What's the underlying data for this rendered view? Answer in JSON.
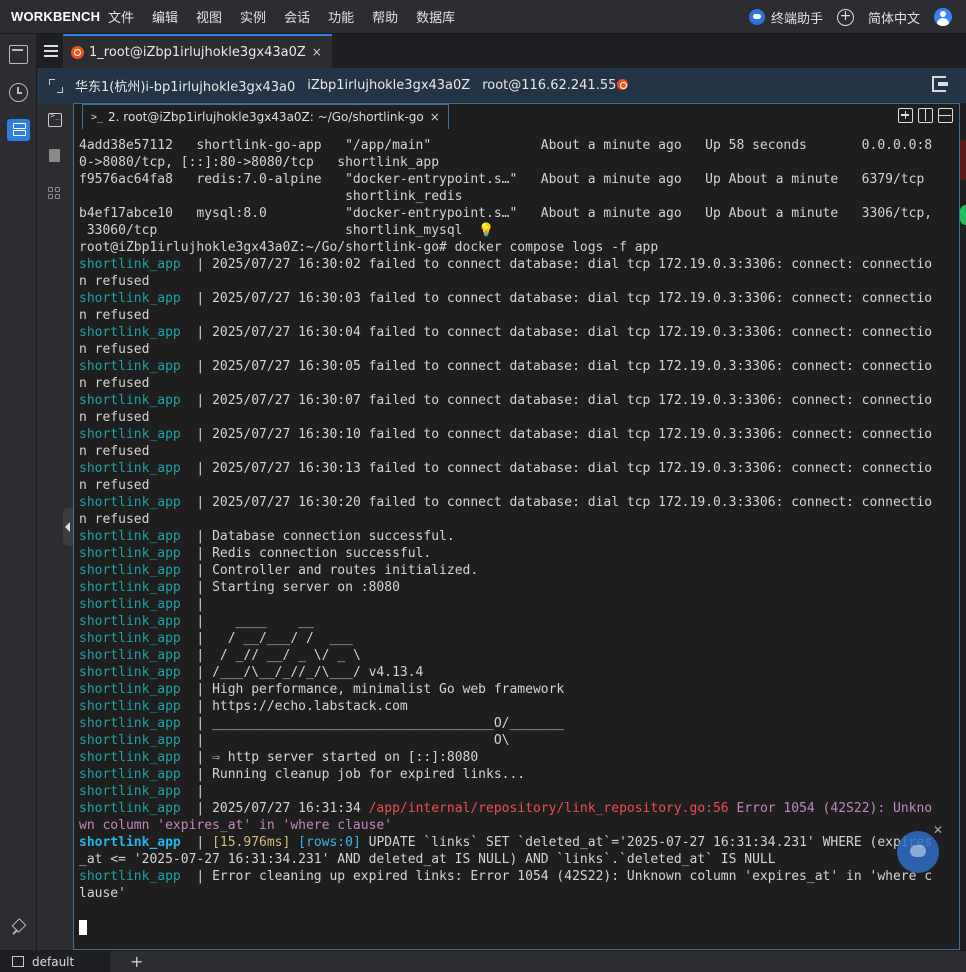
{
  "app": {
    "brand": "WORKBENCH",
    "menu": [
      "文件",
      "编辑",
      "视图",
      "实例",
      "会话",
      "功能",
      "帮助",
      "数据库"
    ],
    "assistant_label": "终端助手",
    "language": "简体中文"
  },
  "session_tab": {
    "label": "1_root@iZbp1irlujhokle3gx43a0Z",
    "close": "×"
  },
  "infobar": {
    "region": "华东1(杭州)i-bp1irlujhokle3gx43a0",
    "host": "iZbp1irlujhokle3gx43a0Z",
    "login": "root@116.62.241.55"
  },
  "terminal_tab": {
    "label": "2. root@iZbp1irlujhokle3gx43a0Z: ~/Go/shortlink-go",
    "close": "×"
  },
  "terminal": {
    "ps": [
      "4add38e57112   shortlink-go-app   \"/app/main\"              About a minute ago   Up 58 seconds       0.0.0.0:8",
      "0->8080/tcp, [::]:80->8080/tcp   shortlink_app",
      "f9576ac64fa8   redis:7.0-alpine   \"docker-entrypoint.s…\"   About a minute ago   Up About a minute   6379/tcp",
      "                                  shortlink_redis",
      "b4ef17abce10   mysql:8.0          \"docker-entrypoint.s…\"   About a minute ago   Up About a minute   3306/tcp,",
      " 33060/tcp                        shortlink_mysql  "
    ],
    "bulb": "💡",
    "prompt": "root@iZbp1irlujhokle3gx43a0Z:~/Go/shortlink-go# docker compose logs -f app",
    "svc": "shortlink_app",
    "sep": "  | ",
    "fail_lines": [
      "2025/07/27 16:30:02 failed to connect database: dial tcp 172.19.0.3:3306: connect: connectio",
      "2025/07/27 16:30:03 failed to connect database: dial tcp 172.19.0.3:3306: connect: connectio",
      "2025/07/27 16:30:04 failed to connect database: dial tcp 172.19.0.3:3306: connect: connectio",
      "2025/07/27 16:30:05 failed to connect database: dial tcp 172.19.0.3:3306: connect: connectio",
      "2025/07/27 16:30:07 failed to connect database: dial tcp 172.19.0.3:3306: connect: connectio",
      "2025/07/27 16:30:10 failed to connect database: dial tcp 172.19.0.3:3306: connect: connectio",
      "2025/07/27 16:30:13 failed to connect database: dial tcp 172.19.0.3:3306: connect: connectio",
      "2025/07/27 16:30:20 failed to connect database: dial tcp 172.19.0.3:3306: connect: connectio"
    ],
    "fail_cont": "n refused",
    "app_lines": [
      "Database connection successful.",
      "Redis connection successful.",
      "Controller and routes initialized.",
      "Starting server on :8080",
      "",
      "   ____    __",
      "  / __/___/ /  ___",
      " / _// __/ _ \\/ _ \\",
      "/___/\\__/_//_/\\___/ v4.13.4",
      "High performance, minimalist Go web framework",
      "https://echo.labstack.com",
      "____________________________________O/_______",
      "                                    O\\",
      "⇨ http server started on [::]:8080",
      "Running cleanup job for expired links...",
      ""
    ],
    "err": {
      "time": "2025/07/27 16:31:34 ",
      "path": "/app/internal/repository/link_repository.go:56",
      "msg": " Error 1054 (42S22): Unkno",
      "cont": "wn column 'expires_at' in 'where clause'"
    },
    "sql": {
      "ms": "[15.976ms]",
      "rows": "[rows:0]",
      "stmt": " UPDATE `links` SET `deleted_at`='2025-07-27 16:31:34.231' WHERE (expires",
      "cont": "_at <= '2025-07-27 16:31:34.231' AND deleted_at IS NULL) AND `links`.`deleted_at` IS NULL"
    },
    "cleanup_err": "Error cleaning up expired links: Error 1054 (42S22): Unknown column 'expires_at' in 'where c",
    "cleanup_cont": "lause'"
  },
  "statusbar": {
    "tab": "default",
    "plus": "+"
  }
}
